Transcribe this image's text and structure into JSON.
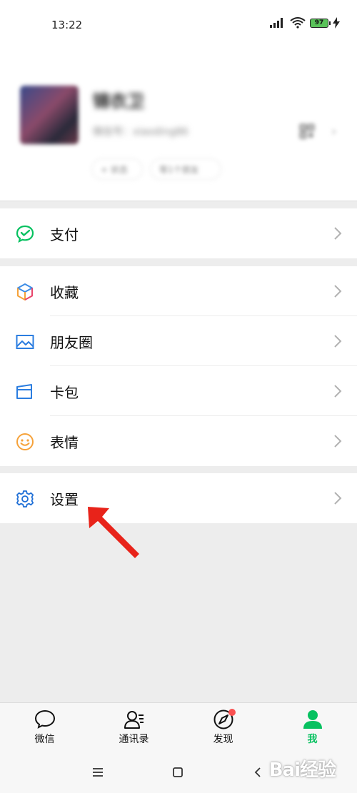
{
  "status_bar": {
    "time": "13:22",
    "battery": "97"
  },
  "profile": {
    "nickname": "锦衣卫",
    "wxid": "微信号：xiaoding86",
    "status_button": "+ 状态",
    "friends_status": "等1个朋友"
  },
  "menu": {
    "pay": "支付",
    "favorites": "收藏",
    "moments": "朋友圈",
    "cards": "卡包",
    "stickers": "表情",
    "settings": "设置"
  },
  "tabbar": {
    "tabs": [
      {
        "label": "微信",
        "icon": "chat-bubble-icon"
      },
      {
        "label": "通讯录",
        "icon": "contacts-icon"
      },
      {
        "label": "发现",
        "icon": "compass-icon"
      },
      {
        "label": "我",
        "icon": "person-icon"
      }
    ],
    "active_color": "#07c160"
  },
  "watermark": "Bai经验",
  "colors": {
    "pay_green": "#07c160",
    "settings_blue": "#1f6fd6",
    "stickers_orange": "#f6a23a",
    "arrow_red": "#e8231a"
  }
}
